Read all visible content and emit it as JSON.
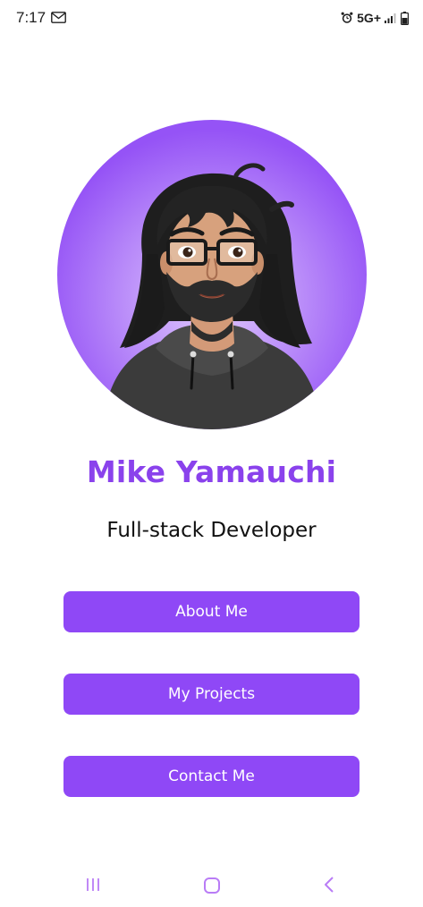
{
  "status_bar": {
    "time": "7:17",
    "network": "5G+",
    "notification_icon": "gmail-icon",
    "alarm_icon": "alarm-icon",
    "signal_icon": "signal-icon",
    "battery_icon": "battery-icon"
  },
  "profile": {
    "name": "Mike Yamauchi",
    "title": "Full-stack Developer",
    "avatar_icon": "avatar-illustration"
  },
  "buttons": {
    "about": "About Me",
    "projects": "My Projects",
    "contact": "Contact Me"
  },
  "system_nav": {
    "recent_icon": "recent-apps-icon",
    "home_icon": "home-icon",
    "back_icon": "back-icon"
  },
  "colors": {
    "accent": "#8a42ec",
    "button": "#8f48f6",
    "avatar_bg_outer": "#9a58f7",
    "avatar_bg_inner": "#d4b4fc"
  }
}
